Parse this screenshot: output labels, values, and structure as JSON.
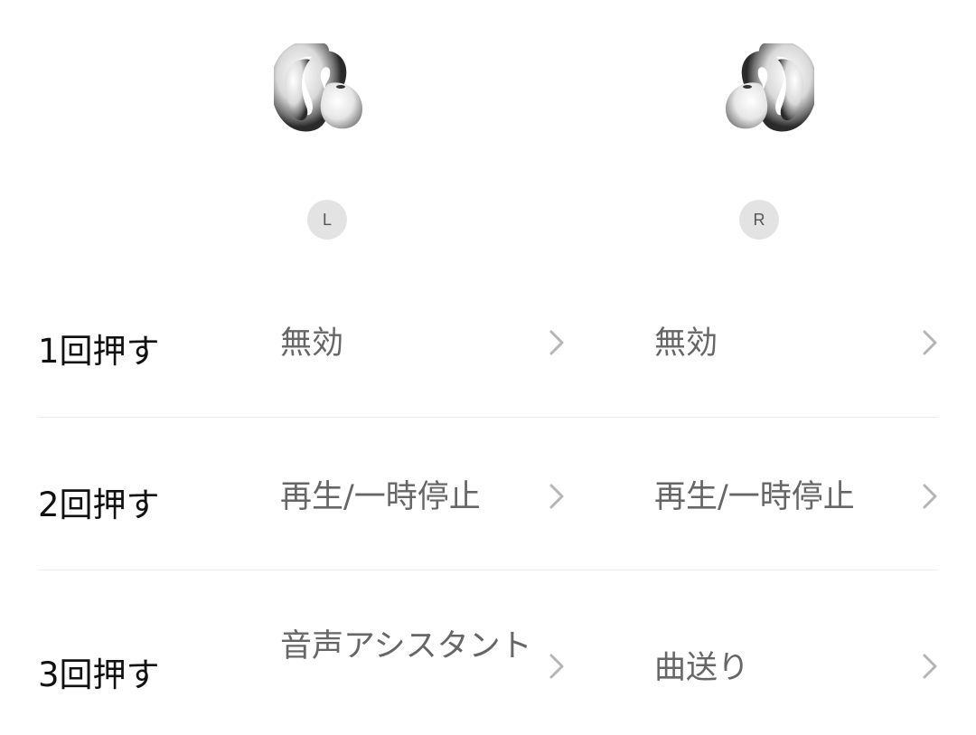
{
  "earbuds": {
    "left_label": "L",
    "right_label": "R"
  },
  "rows": [
    {
      "label": "1回押す",
      "left": "無効",
      "right": "無効"
    },
    {
      "label": "2回押す",
      "left": "再生/一時停止",
      "right": "再生/一時停止"
    },
    {
      "label": "3回押す",
      "left": "音声アシスタント",
      "right": "曲送り"
    }
  ],
  "colors": {
    "background": "#ffffff",
    "row_label": "#111111",
    "value_text": "#666666",
    "chevron": "#b5b5b5",
    "divider": "#ececec",
    "badge_bg": "#e3e3e3"
  }
}
